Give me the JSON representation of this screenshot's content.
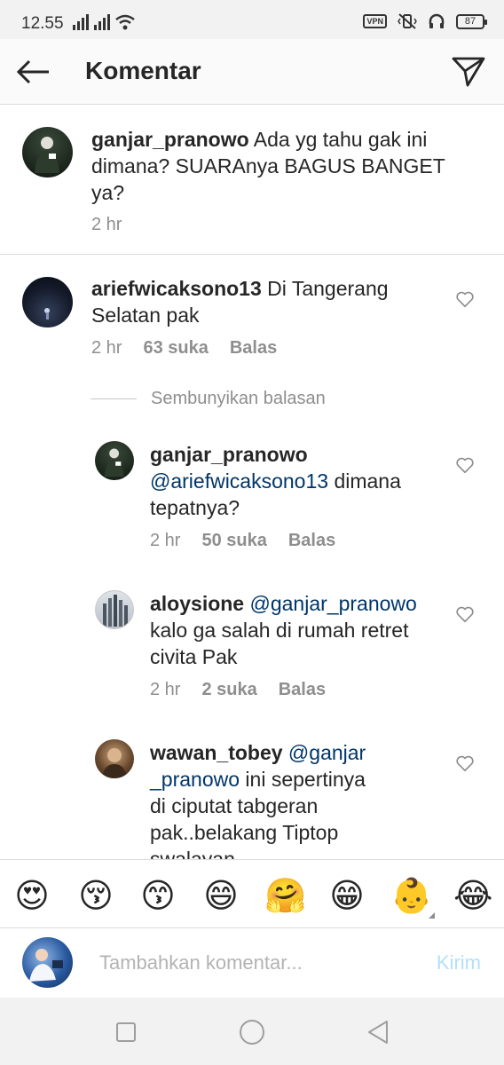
{
  "status_bar": {
    "time": "12.55",
    "battery": "87",
    "vpn_label": "VPN"
  },
  "header": {
    "title": "Komentar",
    "back_icon": "arrow-left-icon",
    "send_icon": "paper-plane-icon"
  },
  "caption": {
    "username": "ganjar_pranowo",
    "text_line1": " Ada yg tahu gak ini",
    "text_line2": "dimana? SUARAnya BAGUS BANGET",
    "text_line3": "ya?",
    "time": "2 hr"
  },
  "comment": {
    "username": "ariefwicaksono13",
    "text_line1": " Di Tangerang",
    "text_line2": "Selatan pak",
    "time": "2 hr",
    "likes": "63 suka",
    "reply": "Balas"
  },
  "hide_replies": "Sembunyikan balasan",
  "replies": [
    {
      "username": "ganjar_pranowo",
      "mention": "@ariefwicaksono13",
      "text_line2_rest": " dimana",
      "text_line3": "tepatnya?",
      "time": "2 hr",
      "likes": "50 suka",
      "reply": "Balas"
    },
    {
      "username": "aloysione",
      "mention": " @ganjar_pranowo",
      "text_line2": "kalo ga salah di rumah retret",
      "text_line3": "civita Pak",
      "time": "2 hr",
      "likes": "2 suka",
      "reply": "Balas"
    },
    {
      "username": "wawan_tobey",
      "mention_part1": " @ganjar",
      "mention_part2": "_pranowo",
      "text_line2_rest": " ini sepertinya",
      "text_line3": "di ciputat tabgeran",
      "text_line4": "pak..belakang Tiptop",
      "text_line5": "swalayan"
    }
  ],
  "emojis": [
    "😍",
    "😚",
    "😙",
    "😄",
    "🤗",
    "😁",
    "👶",
    "😂"
  ],
  "input": {
    "placeholder": "Tambahkan komentar...",
    "submit": "Kirim"
  },
  "colors": {
    "mention": "#003569",
    "muted": "#8e8e8e",
    "submit_disabled": "#b2dffc"
  }
}
